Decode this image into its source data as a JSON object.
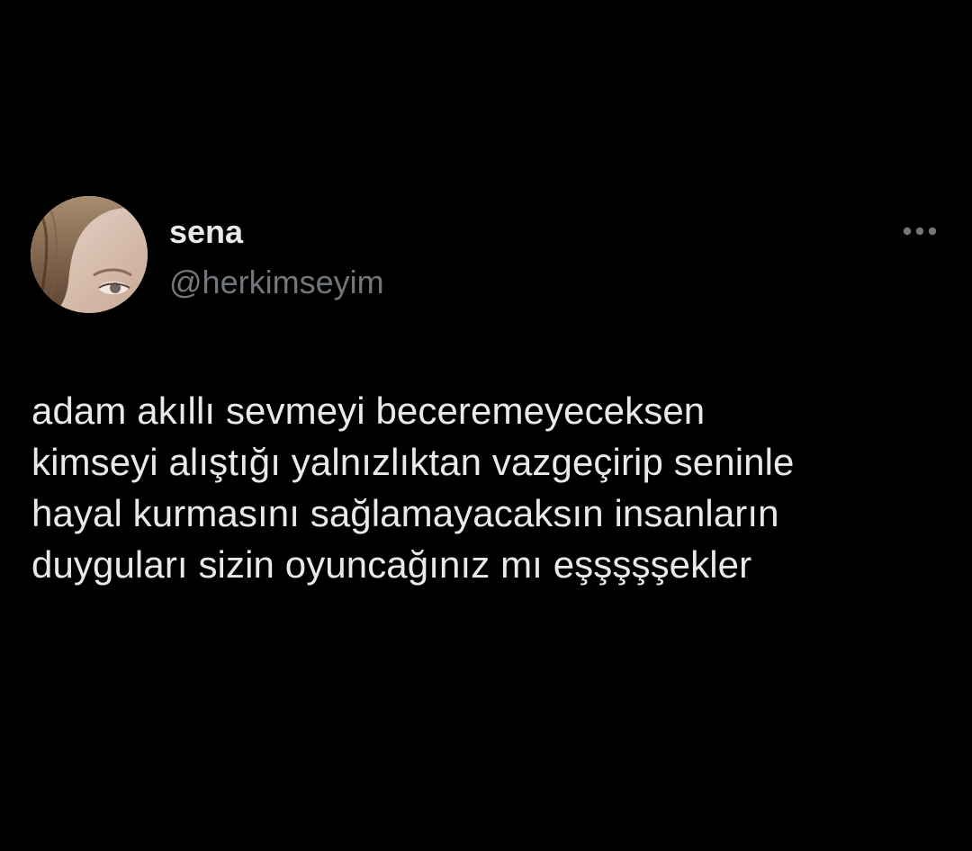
{
  "tweet": {
    "author": {
      "display_name": "sena",
      "handle": "@herkimseyim",
      "avatar_icon": "profile-photo"
    },
    "more_icon": "more-horizontal-icon",
    "text": "adam akıllı sevmeyi beceremeyeceksen\nkimseyi alıştığı yalnızlıktan vazgeçirip seninle\nhayal kurmasını sağlamayacaksın insanların\nduyguları sizin oyuncağınız mı eşşşşşekler"
  },
  "colors": {
    "background": "#000000",
    "primary_text": "#e7e9ea",
    "secondary_text": "#71767b"
  }
}
